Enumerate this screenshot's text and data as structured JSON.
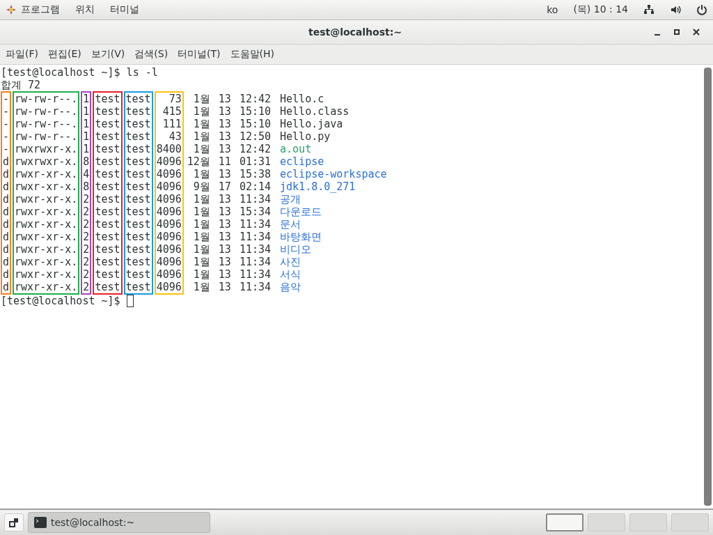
{
  "top_bar": {
    "apps": "프로그램",
    "places": "위치",
    "app": "터미널",
    "language": "ko",
    "clock": "(목) 10 : 14"
  },
  "window": {
    "title": "test@localhost:~",
    "menu": [
      "파일(F)",
      "편집(E)",
      "보기(V)",
      "검색(S)",
      "터미널(T)",
      "도움말(H)"
    ]
  },
  "terminal": {
    "lines": [
      "[test@localhost ~]$ ls -l",
      "합계 72"
    ],
    "columns": [
      {
        "color": "#f58220",
        "cells": [
          "-",
          "-",
          "-",
          "-",
          "-",
          "d",
          "d",
          "d",
          "d",
          "d",
          "d",
          "d",
          "d",
          "d",
          "d",
          "d"
        ]
      },
      {
        "color": "#1fae4b",
        "cells": [
          "rw-rw-r--.",
          "rw-rw-r--.",
          "rw-rw-r--.",
          "rw-rw-r--.",
          "rwxrwxr-x.",
          "rwxrwxr-x.",
          "rwxr-xr-x.",
          "rwxr-xr-x.",
          "rwxr-xr-x.",
          "rwxr-xr-x.",
          "rwxr-xr-x.",
          "rwxr-xr-x.",
          "rwxr-xr-x.",
          "rwxr-xr-x.",
          "rwxr-xr-x.",
          "rwxr-xr-x."
        ]
      },
      {
        "color": "#a347b8",
        "cells": [
          "1",
          "1",
          "1",
          "1",
          "1",
          "8",
          "4",
          "8",
          "2",
          "2",
          "2",
          "2",
          "2",
          "2",
          "2",
          "2"
        ]
      },
      {
        "color": "#e8202a",
        "cells": [
          "test",
          "test",
          "test",
          "test",
          "test",
          "test",
          "test",
          "test",
          "test",
          "test",
          "test",
          "test",
          "test",
          "test",
          "test",
          "test"
        ]
      },
      {
        "color": "#1a9be0",
        "cells": [
          "test",
          "test",
          "test",
          "test",
          "test",
          "test",
          "test",
          "test",
          "test",
          "test",
          "test",
          "test",
          "test",
          "test",
          "test",
          "test"
        ]
      },
      {
        "color": "#ffc20e",
        "cells": [
          "73",
          "415",
          "111",
          "43",
          "8400",
          "4096",
          "4096",
          "4096",
          "4096",
          "4096",
          "4096",
          "4096",
          "4096",
          "4096",
          "4096",
          "4096"
        ]
      },
      {
        "cells": [
          "1월",
          "1월",
          "1월",
          "1월",
          "1월",
          "12월",
          "1월",
          "9월",
          "1월",
          "1월",
          "1월",
          "1월",
          "1월",
          "1월",
          "1월",
          "1월"
        ]
      },
      {
        "cells": [
          "13",
          "13",
          "13",
          "13",
          "13",
          "11",
          "13",
          "17",
          "13",
          "13",
          "13",
          "13",
          "13",
          "13",
          "13",
          "13"
        ]
      },
      {
        "cells": [
          "12:42",
          "15:10",
          "15:10",
          "12:50",
          "12:42",
          "01:31",
          "15:38",
          "02:14",
          "11:34",
          "15:34",
          "11:34",
          "11:34",
          "11:34",
          "11:34",
          "11:34",
          "11:34"
        ]
      }
    ],
    "entries": [
      {
        "name": "Hello.c",
        "kind": "file"
      },
      {
        "name": "Hello.class",
        "kind": "file"
      },
      {
        "name": "Hello.java",
        "kind": "file"
      },
      {
        "name": "Hello.py",
        "kind": "file"
      },
      {
        "name": "a.out",
        "kind": "exec"
      },
      {
        "name": "eclipse",
        "kind": "dir"
      },
      {
        "name": "eclipse-workspace",
        "kind": "dir"
      },
      {
        "name": "jdk1.8.0_271",
        "kind": "dir"
      },
      {
        "name": "공개",
        "kind": "dir"
      },
      {
        "name": "다운로드",
        "kind": "dir"
      },
      {
        "name": "문서",
        "kind": "dir"
      },
      {
        "name": "바탕화면",
        "kind": "dir"
      },
      {
        "name": "비디오",
        "kind": "dir"
      },
      {
        "name": "사진",
        "kind": "dir"
      },
      {
        "name": "서식",
        "kind": "dir"
      },
      {
        "name": "음악",
        "kind": "dir"
      }
    ],
    "prompt": "[test@localhost ~]$"
  },
  "taskbar": {
    "task": "test@localhost:~",
    "workspaces": [
      {
        "selected": true
      },
      {
        "selected": false
      },
      {
        "selected": false
      },
      {
        "selected": false
      }
    ]
  }
}
